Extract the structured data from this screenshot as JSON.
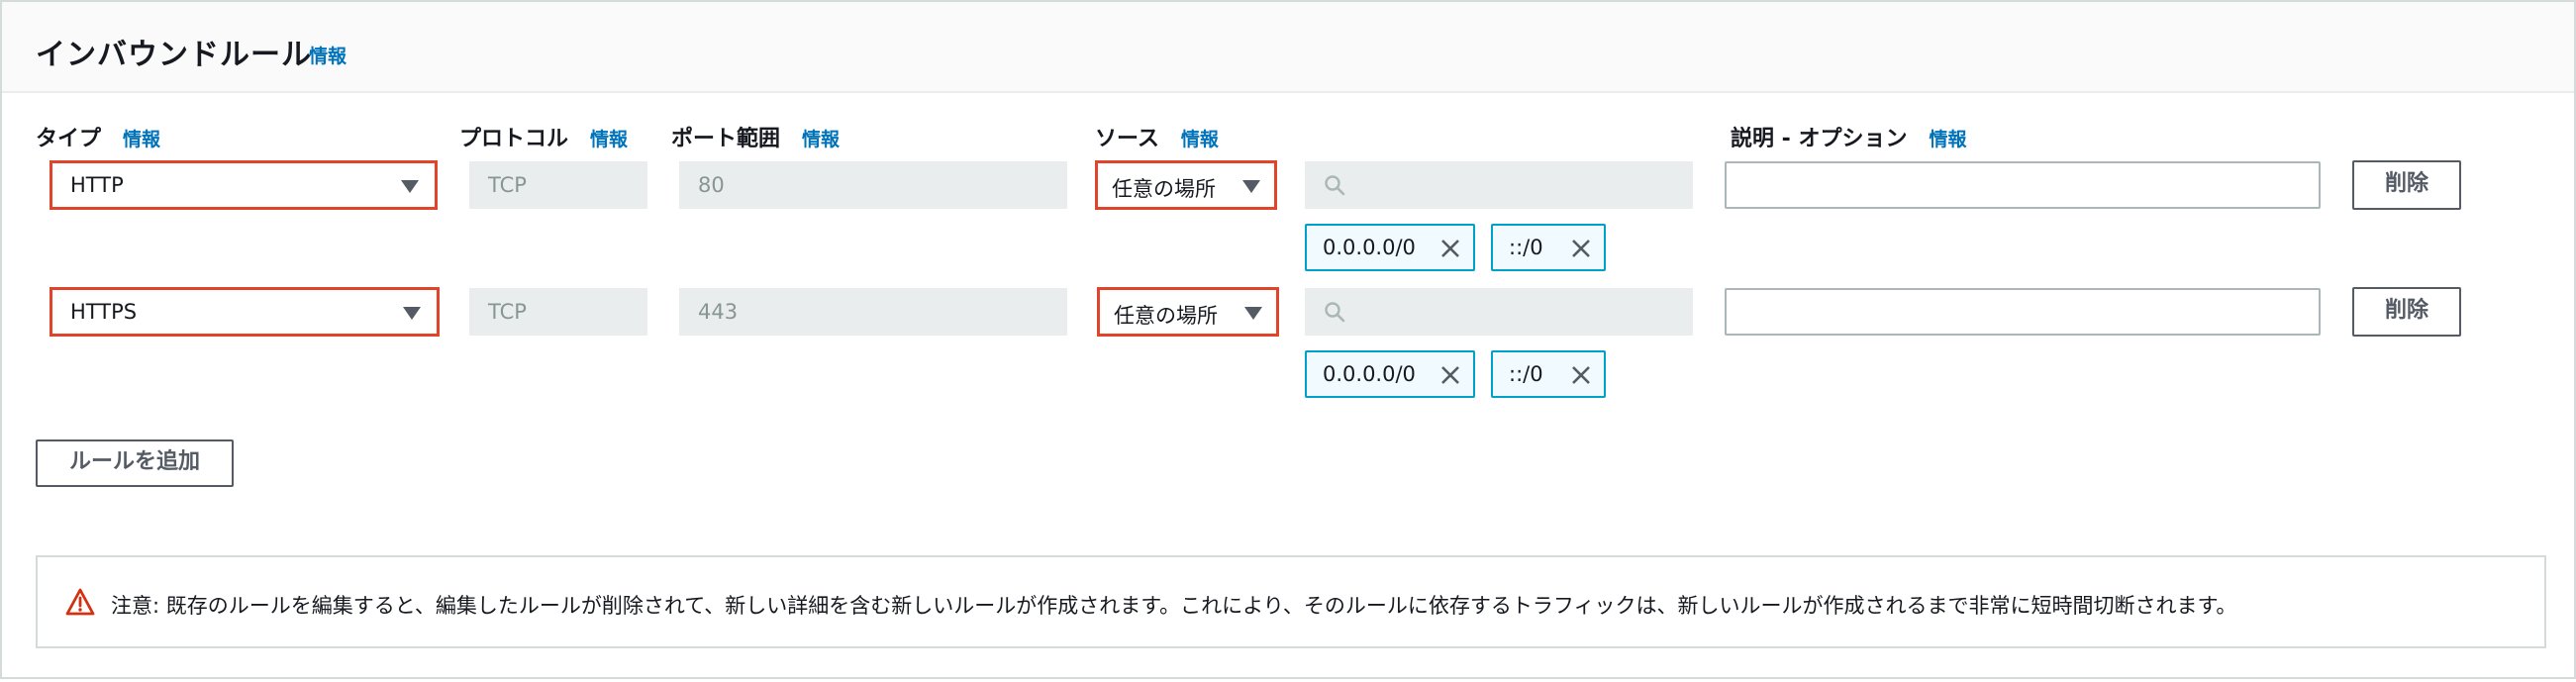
{
  "panel": {
    "title": "インバウンドルール",
    "info": "情報"
  },
  "columns": {
    "type": {
      "label": "タイプ",
      "info": "情報"
    },
    "protocol": {
      "label": "プロトコル",
      "info": "情報"
    },
    "port_range": {
      "label": "ポート範囲",
      "info": "情報"
    },
    "source": {
      "label": "ソース",
      "info": "情報"
    },
    "description": {
      "label": "説明 - オプション",
      "info": "情報"
    }
  },
  "rules": [
    {
      "type": "HTTP",
      "protocol": "TCP",
      "port_range": "80",
      "source": "任意の場所",
      "cidrs": [
        "0.0.0.0/0",
        "::/0"
      ],
      "description": "",
      "delete_label": "削除"
    },
    {
      "type": "HTTPS",
      "protocol": "TCP",
      "port_range": "443",
      "source": "任意の場所",
      "cidrs": [
        "0.0.0.0/0",
        "::/0"
      ],
      "description": "",
      "delete_label": "削除"
    }
  ],
  "add_rule_label": "ルールを追加",
  "warning": {
    "text": "注意: 既存のルールを編集すると、編集したルールが削除されて、新しい詳細を含む新しいルールが作成されます。これにより、そのルールに依存するトラフィックは、新しいルールが作成されるまで非常に短時間切断されます。"
  },
  "colors": {
    "highlight_border": "#e0442b",
    "info_link": "#0073bb",
    "token_border": "#00a1c9",
    "warning_icon": "#d13212"
  },
  "icons": {
    "select_caret": "caret-down-icon",
    "search": "search-icon",
    "token_remove": "close-icon",
    "warning": "warning-icon"
  }
}
